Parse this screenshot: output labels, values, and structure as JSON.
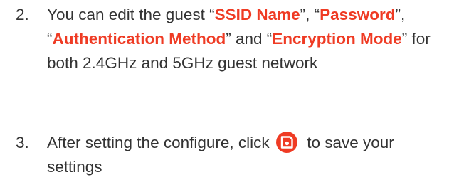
{
  "steps": [
    {
      "number": "2.",
      "parts": {
        "t1": "You can edit the guest “",
        "h1": "SSID Name",
        "t2": "”, “",
        "h2": "Password",
        "t3": "”, “",
        "h3": "Authentication Method",
        "t4": "” and “",
        "h4": "Encryption Mode",
        "t5": "” for both 2.4GHz and 5GHz guest network"
      }
    },
    {
      "number": "3.",
      "parts": {
        "t1": "After setting the configure, click",
        "t2": "to save your settings"
      },
      "icon": "save-icon"
    }
  ],
  "colors": {
    "highlight": "#ef3b24",
    "text": "#333333",
    "icon_bg": "#ef3b24"
  }
}
